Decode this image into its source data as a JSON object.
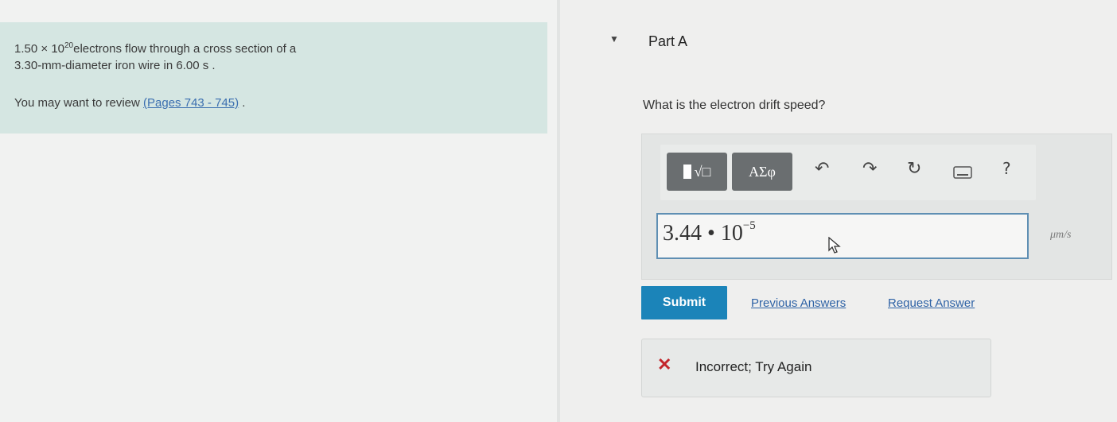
{
  "problem": {
    "mantissa": "1.50",
    "times": "×",
    "base": "10",
    "exponent": "20",
    "line1_rest": "electrons flow through a cross section of a",
    "line2": "3.30-mm-diameter iron wire in 6.00 s .",
    "review_prefix": "You may want to review ",
    "review_link": "(Pages 743 - 745)",
    "review_suffix": " ."
  },
  "part": {
    "toggle_icon": "▼",
    "title": "Part A",
    "question": "What is the electron drift speed?"
  },
  "toolbar": {
    "template_label": "√□",
    "greek_label": "ΑΣφ",
    "undo_icon": "↶",
    "redo_icon": "↷",
    "reset_icon": "↻",
    "keyboard_icon": "keyboard-icon",
    "help_label": "?"
  },
  "answer": {
    "mantissa": "3.44",
    "dot": "•",
    "base": "10",
    "exponent": "−5",
    "unit": "μm/s"
  },
  "actions": {
    "submit": "Submit",
    "previous_answers": "Previous Answers",
    "request_answer": "Request Answer"
  },
  "feedback": {
    "icon": "✕",
    "text": "Incorrect; Try Again"
  },
  "colors": {
    "accent": "#1b84b9",
    "error": "#c3262b",
    "link": "#2f63a6",
    "problem_bg": "#d5e6e2"
  }
}
